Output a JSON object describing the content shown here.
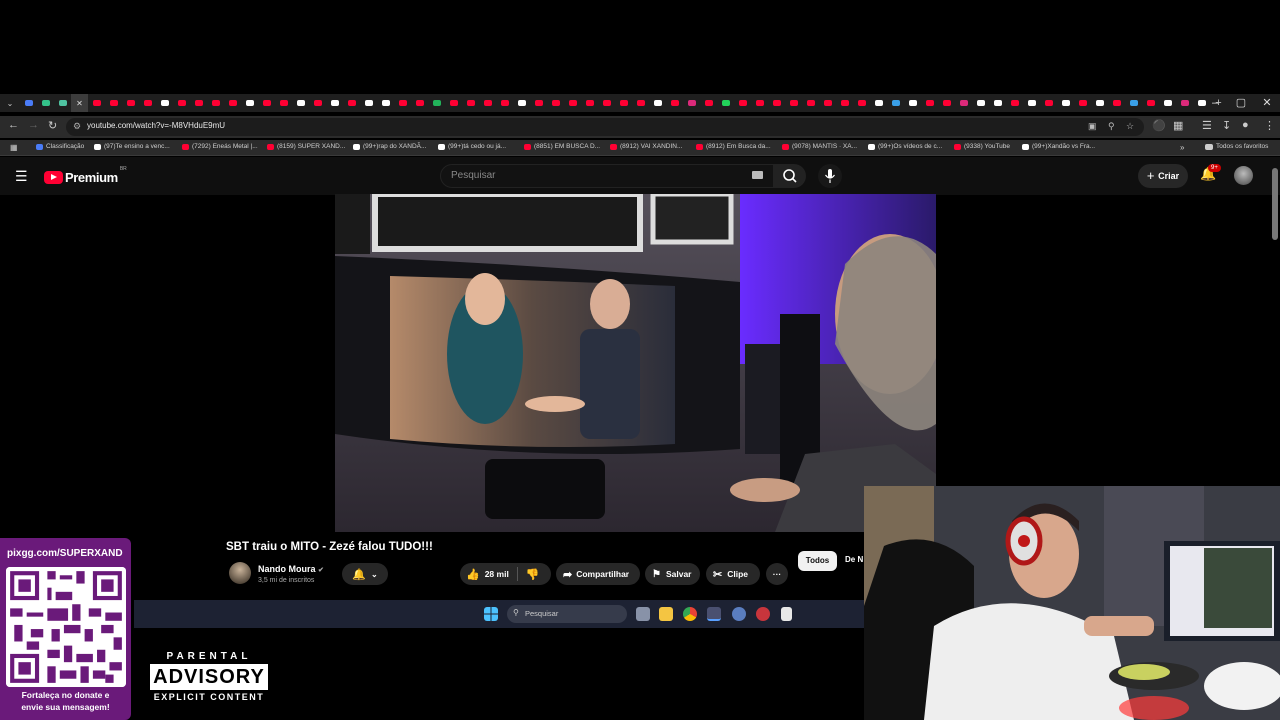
{
  "browser": {
    "url": "youtube.com/watch?v=-M8VHduE9mU",
    "window_controls": [
      "–",
      "▢",
      "✕"
    ],
    "tab_icons": [
      "#4a7cf7",
      "#34c28a",
      "#4fc3a1",
      "#ff0033",
      "#ff0033",
      "#ff0033",
      "#ff0033",
      "#ff0033",
      "#ffffff",
      "#ff0033",
      "#ff0033",
      "#ff0033",
      "#ff0033",
      "#ffffff",
      "#ff0033",
      "#ff0033",
      "#ffffff",
      "#ff0033",
      "#ffffff",
      "#ff0033",
      "#ffffff",
      "#ffffff",
      "#ff0033",
      "#ff0033",
      "#22b35a",
      "#ff0033",
      "#ff0033",
      "#ff0033",
      "#ff0033",
      "#ffffff",
      "#ff0033",
      "#ff0033",
      "#ff0033",
      "#ff0033",
      "#ff0033",
      "#ff0033",
      "#ff0033",
      "#ffffff",
      "#ff0033",
      "#dd2a7b",
      "#ff0033",
      "#22d35a",
      "#ff0033",
      "#ff0033",
      "#ff0033",
      "#ff0033",
      "#ff0033",
      "#ff0033",
      "#ff0033",
      "#ff0033",
      "#ffffff",
      "#3aa0e8",
      "#ffffff",
      "#ff0033",
      "#ff0033",
      "#dd2a7b",
      "#ffffff",
      "#ffffff",
      "#ff0033",
      "#ffffff",
      "#ff0033",
      "#ffffff",
      "#ff0033",
      "#ffffff",
      "#ff0033",
      "#3aa0e8",
      "#ff0033",
      "#ffffff",
      "#dd2a7b",
      "#ffffff"
    ],
    "new_tab": "+",
    "bookmarks": [
      {
        "label": "Classificação",
        "color": "#4a7cf7"
      },
      {
        "label": "(97)Te ensino a venc...",
        "color": "#ffffff"
      },
      {
        "label": "(7292) Eneás Metal |...",
        "color": "#ff0033"
      },
      {
        "label": "(8159) SUPER XAND...",
        "color": "#ff0033"
      },
      {
        "label": "(99+)rap do XANDÃ...",
        "color": "#ffffff"
      },
      {
        "label": "(99+)tá cedo ou já...",
        "color": "#ffffff"
      },
      {
        "label": "(8851) EM BUSCA D...",
        "color": "#ff0033"
      },
      {
        "label": "(8912) VAI XANDIN...",
        "color": "#ff0033"
      },
      {
        "label": "(8912) Em Busca da...",
        "color": "#ff0033"
      },
      {
        "label": "(9078) MANTIS · XA...",
        "color": "#ff0033"
      },
      {
        "label": "(99+)Os vídeos de c...",
        "color": "#ffffff"
      },
      {
        "label": "(9338) YouTube",
        "color": "#ff0033"
      },
      {
        "label": "(99+)Xandão vs Fra...",
        "color": "#ffffff"
      }
    ],
    "bookmarks_more": "»",
    "all_bookmarks": "Todos os favoritos"
  },
  "youtube": {
    "logo_text": "Premium",
    "country_code": "BR",
    "search_placeholder": "Pesquisar",
    "create_label": "Criar",
    "notif_badge": "9+",
    "video": {
      "title": "SBT traiu o MITO - Zezé falou TUDO!!!",
      "channel": "Nando Moura",
      "subscribers": "3,5 mi de inscritos",
      "likes": "28 mil",
      "share": "Compartilhar",
      "save": "Salvar",
      "clip": "Clipe",
      "more": "···"
    },
    "chips": [
      "Todos",
      "De N"
    ]
  },
  "taskbar": {
    "search_placeholder": "Pesquisar"
  },
  "overlay": {
    "pix_url": "pixgg.com/SUPERXAND",
    "pix_msg_line1": "Fortaleça no donate e",
    "pix_msg_line2": "envie sua mensagem!",
    "advisory_line1": "PARENTAL",
    "advisory_line2": "ADVISORY",
    "advisory_line3": "EXPLICIT CONTENT"
  }
}
